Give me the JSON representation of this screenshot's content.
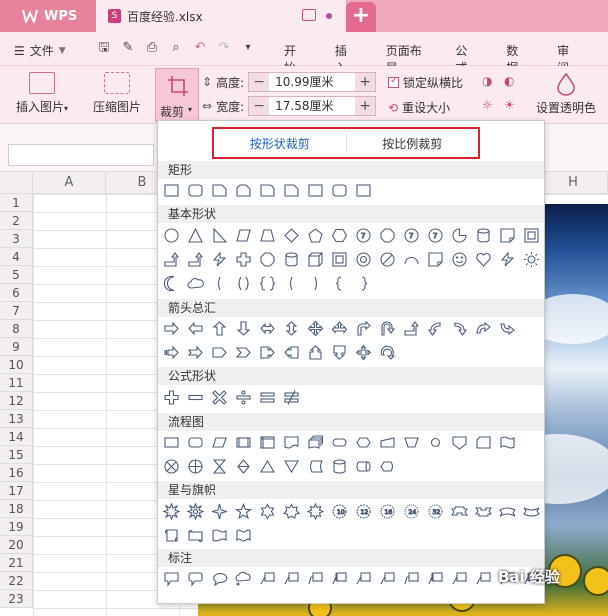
{
  "titlebar": {
    "app_name": "WPS",
    "file_tab": "百度经验.xlsx",
    "file_icon_letter": "S"
  },
  "menubar": {
    "file_label": "文件",
    "tabs": [
      "开始",
      "插入",
      "页面布局",
      "公式",
      "数据",
      "审阅"
    ]
  },
  "ribbon": {
    "insert_picture": "插入图片",
    "compress_picture": "压缩图片",
    "crop": "裁剪",
    "height_label": "高度:",
    "height_value": "10.99厘米",
    "width_label": "宽度:",
    "width_value": "17.58厘米",
    "lock_ratio": "锁定纵横比",
    "reset_size": "重设大小",
    "set_transparent": "设置透明色",
    "minus": "−",
    "plus": "+"
  },
  "grid": {
    "columns": [
      "A",
      "B",
      "H"
    ],
    "rows": [
      "1",
      "2",
      "3",
      "4",
      "5",
      "6",
      "7",
      "8",
      "9",
      "10",
      "11",
      "12",
      "13",
      "14",
      "15",
      "16",
      "17",
      "18",
      "19",
      "20",
      "21",
      "22",
      "23"
    ]
  },
  "crop_panel": {
    "crop_by_shape": "按形状裁剪",
    "crop_by_ratio": "按比例裁剪",
    "sections": [
      {
        "title": "矩形"
      },
      {
        "title": "基本形状"
      },
      {
        "title": "箭头总汇"
      },
      {
        "title": "公式形状"
      },
      {
        "title": "流程图"
      },
      {
        "title": "星与旗帜"
      },
      {
        "title": "标注"
      }
    ]
  },
  "watermark": "Bai 经验"
}
